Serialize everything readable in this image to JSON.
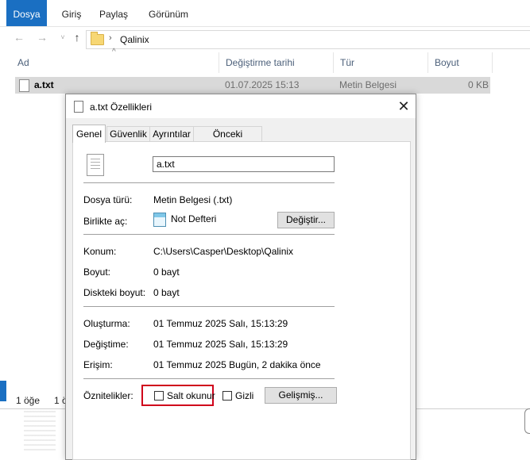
{
  "ribbon": {
    "tabs": [
      "Dosya",
      "Giriş",
      "Paylaş",
      "Görünüm"
    ]
  },
  "address": {
    "path": "Qalinix",
    "separator": "›"
  },
  "columns": [
    "Ad",
    "Değiştirme tarihi",
    "Tür",
    "Boyut"
  ],
  "file": {
    "name": "a.txt",
    "date": "01.07.2025 15:13",
    "type": "Metin Belgesi",
    "size": "0 KB"
  },
  "status": {
    "count": "1 öğe",
    "selected": "1 ö"
  },
  "dialog": {
    "title": "a.txt Özellikleri",
    "close": "✕",
    "tabs": [
      "Genel",
      "Güvenlik",
      "Ayrıntılar",
      "Önceki Sürümler"
    ],
    "filename": "a.txt",
    "labels": {
      "file_type": "Dosya türü:",
      "open_with": "Birlikte aç:",
      "location": "Konum:",
      "size": "Boyut:",
      "size_on_disk": "Diskteki boyut:",
      "created": "Oluşturma:",
      "modified": "Değiştime:",
      "accessed": "Erişim:",
      "attributes": "Öznitelikler:"
    },
    "values": {
      "file_type": "Metin Belgesi (.txt)",
      "open_with": "Not Defteri",
      "location": "C:\\Users\\Casper\\Desktop\\Qalinix",
      "size": "0 bayt",
      "size_on_disk": "0 bayt",
      "created": "01 Temmuz 2025 Salı, 15:13:29",
      "modified": "01 Temmuz 2025 Salı, 15:13:29",
      "accessed": "01 Temmuz 2025 Bugün, 2 dakika önce"
    },
    "change_button": "Değiştir...",
    "readonly_label": "Salt okunur",
    "hidden_label": "Gizli",
    "advanced_button": "Gelişmiş...",
    "readonly_checked": false,
    "hidden_checked": false,
    "highlight_color": "#d0021b"
  },
  "colors": {
    "ribbon_active": "#1a6fc2",
    "column_header_text": "#4c607a",
    "selected_row": "#d9d9d9"
  }
}
